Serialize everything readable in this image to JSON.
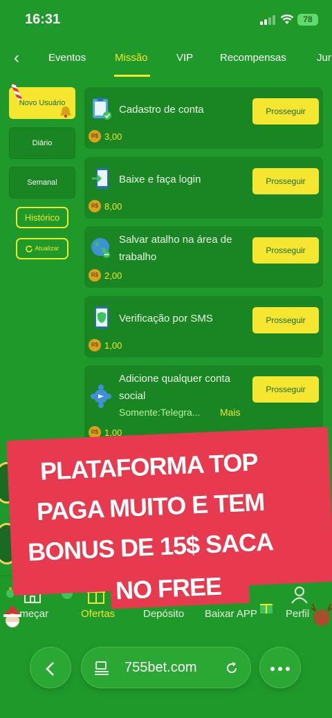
{
  "status_bar": {
    "time": "16:31",
    "battery": "78"
  },
  "tabs": [
    {
      "label": "Eventos"
    },
    {
      "label": "Missão"
    },
    {
      "label": "VIP"
    },
    {
      "label": "Recompensas"
    },
    {
      "label": "Jur"
    }
  ],
  "sidebar": {
    "novo_usuario": "Novo Usuário",
    "diario": "Diário",
    "semanal": "Semanal",
    "historico": "Histórico",
    "atualizar": "Atualizar"
  },
  "missions": [
    {
      "title": "Cadastro de conta",
      "reward": "3,00",
      "button": "Prosseguir",
      "icon": "clipboard-icon"
    },
    {
      "title": "Baixe e faça login",
      "reward": "8,00",
      "button": "Prosseguir",
      "icon": "phone-download-icon"
    },
    {
      "title": "Salvar atalho na área de trabalho",
      "reward": "2,00",
      "button": "Prosseguir",
      "icon": "globe-link-icon"
    },
    {
      "title": "Verificação por SMS",
      "reward": "1,00",
      "button": "Prosseguir",
      "icon": "phone-shield-icon"
    },
    {
      "title": "Adicione qualquer conta social",
      "reward": "1,00",
      "button": "Prosseguir",
      "icon": "social-network-icon",
      "subtitle": "Somente:Telegra...",
      "more": "Mais"
    }
  ],
  "currency_symbol": "R$",
  "overlay": {
    "lines": [
      "PLATAFORMA TOP",
      "PAGA MUITO E TEM",
      "BONUS DE 15$ SACA",
      "NO FREE"
    ]
  },
  "bottom_nav": [
    {
      "label": "omeçar",
      "icon": "home-icon"
    },
    {
      "label": "Ofertas",
      "icon": "gift-icon"
    },
    {
      "label": "Depósito",
      "icon": "deposit-icon"
    },
    {
      "label": "Baixar APP",
      "icon": "download-icon"
    },
    {
      "label": "Perfil",
      "icon": "user-icon"
    }
  ],
  "browser": {
    "url": "755bet.com"
  },
  "colors": {
    "background": "#1f9a2a",
    "card": "#1a8523",
    "accent": "#f5e62f",
    "overlay": "#e83a4e"
  }
}
